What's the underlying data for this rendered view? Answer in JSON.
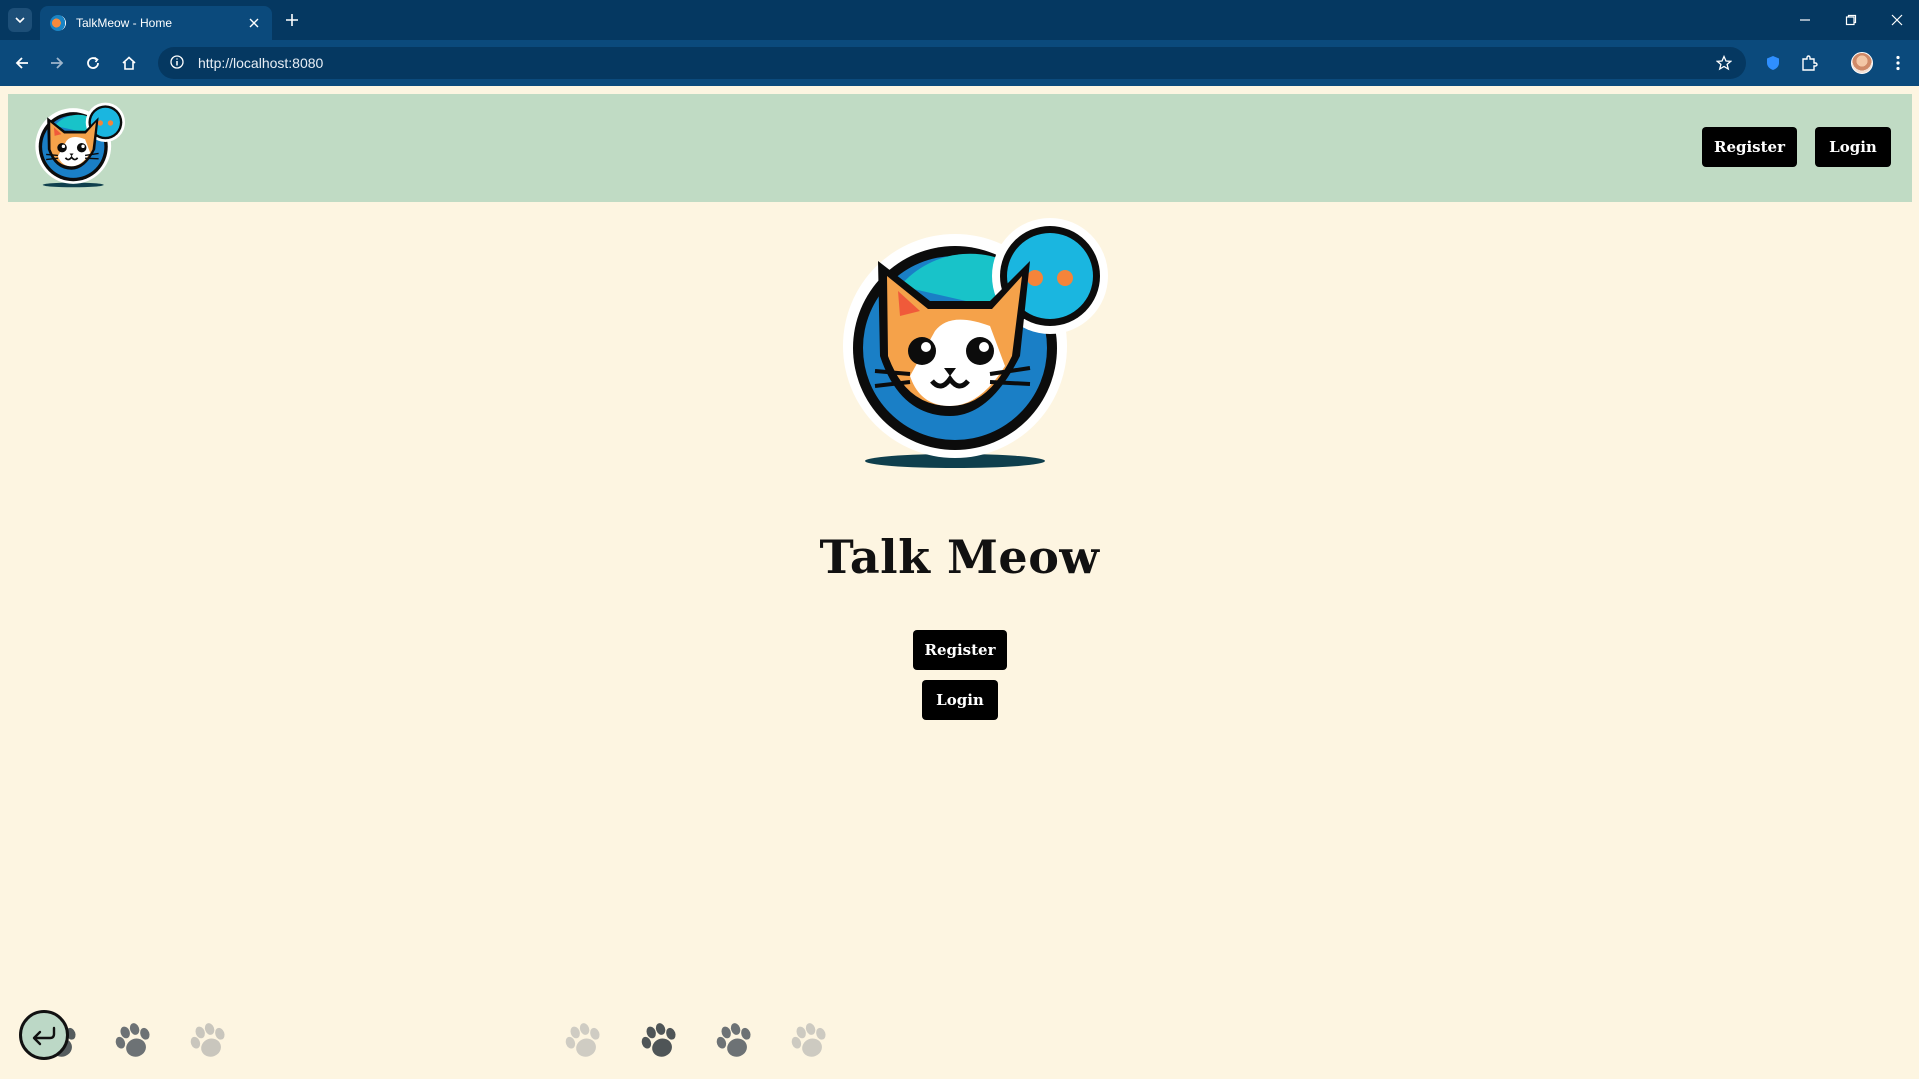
{
  "browser": {
    "tab_title": "TalkMeow - Home",
    "url": "http://localhost:8080"
  },
  "navbar": {
    "register_label": "Register",
    "login_label": "Login"
  },
  "hero": {
    "title": "Talk Meow",
    "register_label": "Register",
    "login_label": "Login"
  },
  "colors": {
    "page_background": "#fdf5e1",
    "navbar_background": "#c0dbc4",
    "button_background": "#000000",
    "chrome_dark": "#053861",
    "chrome_toolbar": "#0b4a7c"
  },
  "icons": [
    "tab-search-icon",
    "close-icon",
    "plus-icon",
    "minimize-icon",
    "restore-icon",
    "back-arrow-icon",
    "forward-arrow-icon",
    "reload-icon",
    "home-icon",
    "info-icon",
    "star-icon",
    "shield-icon",
    "puzzle-icon",
    "kebab-menu-icon",
    "cat-logo-icon",
    "paw-icon",
    "return-arrow-icon"
  ]
}
